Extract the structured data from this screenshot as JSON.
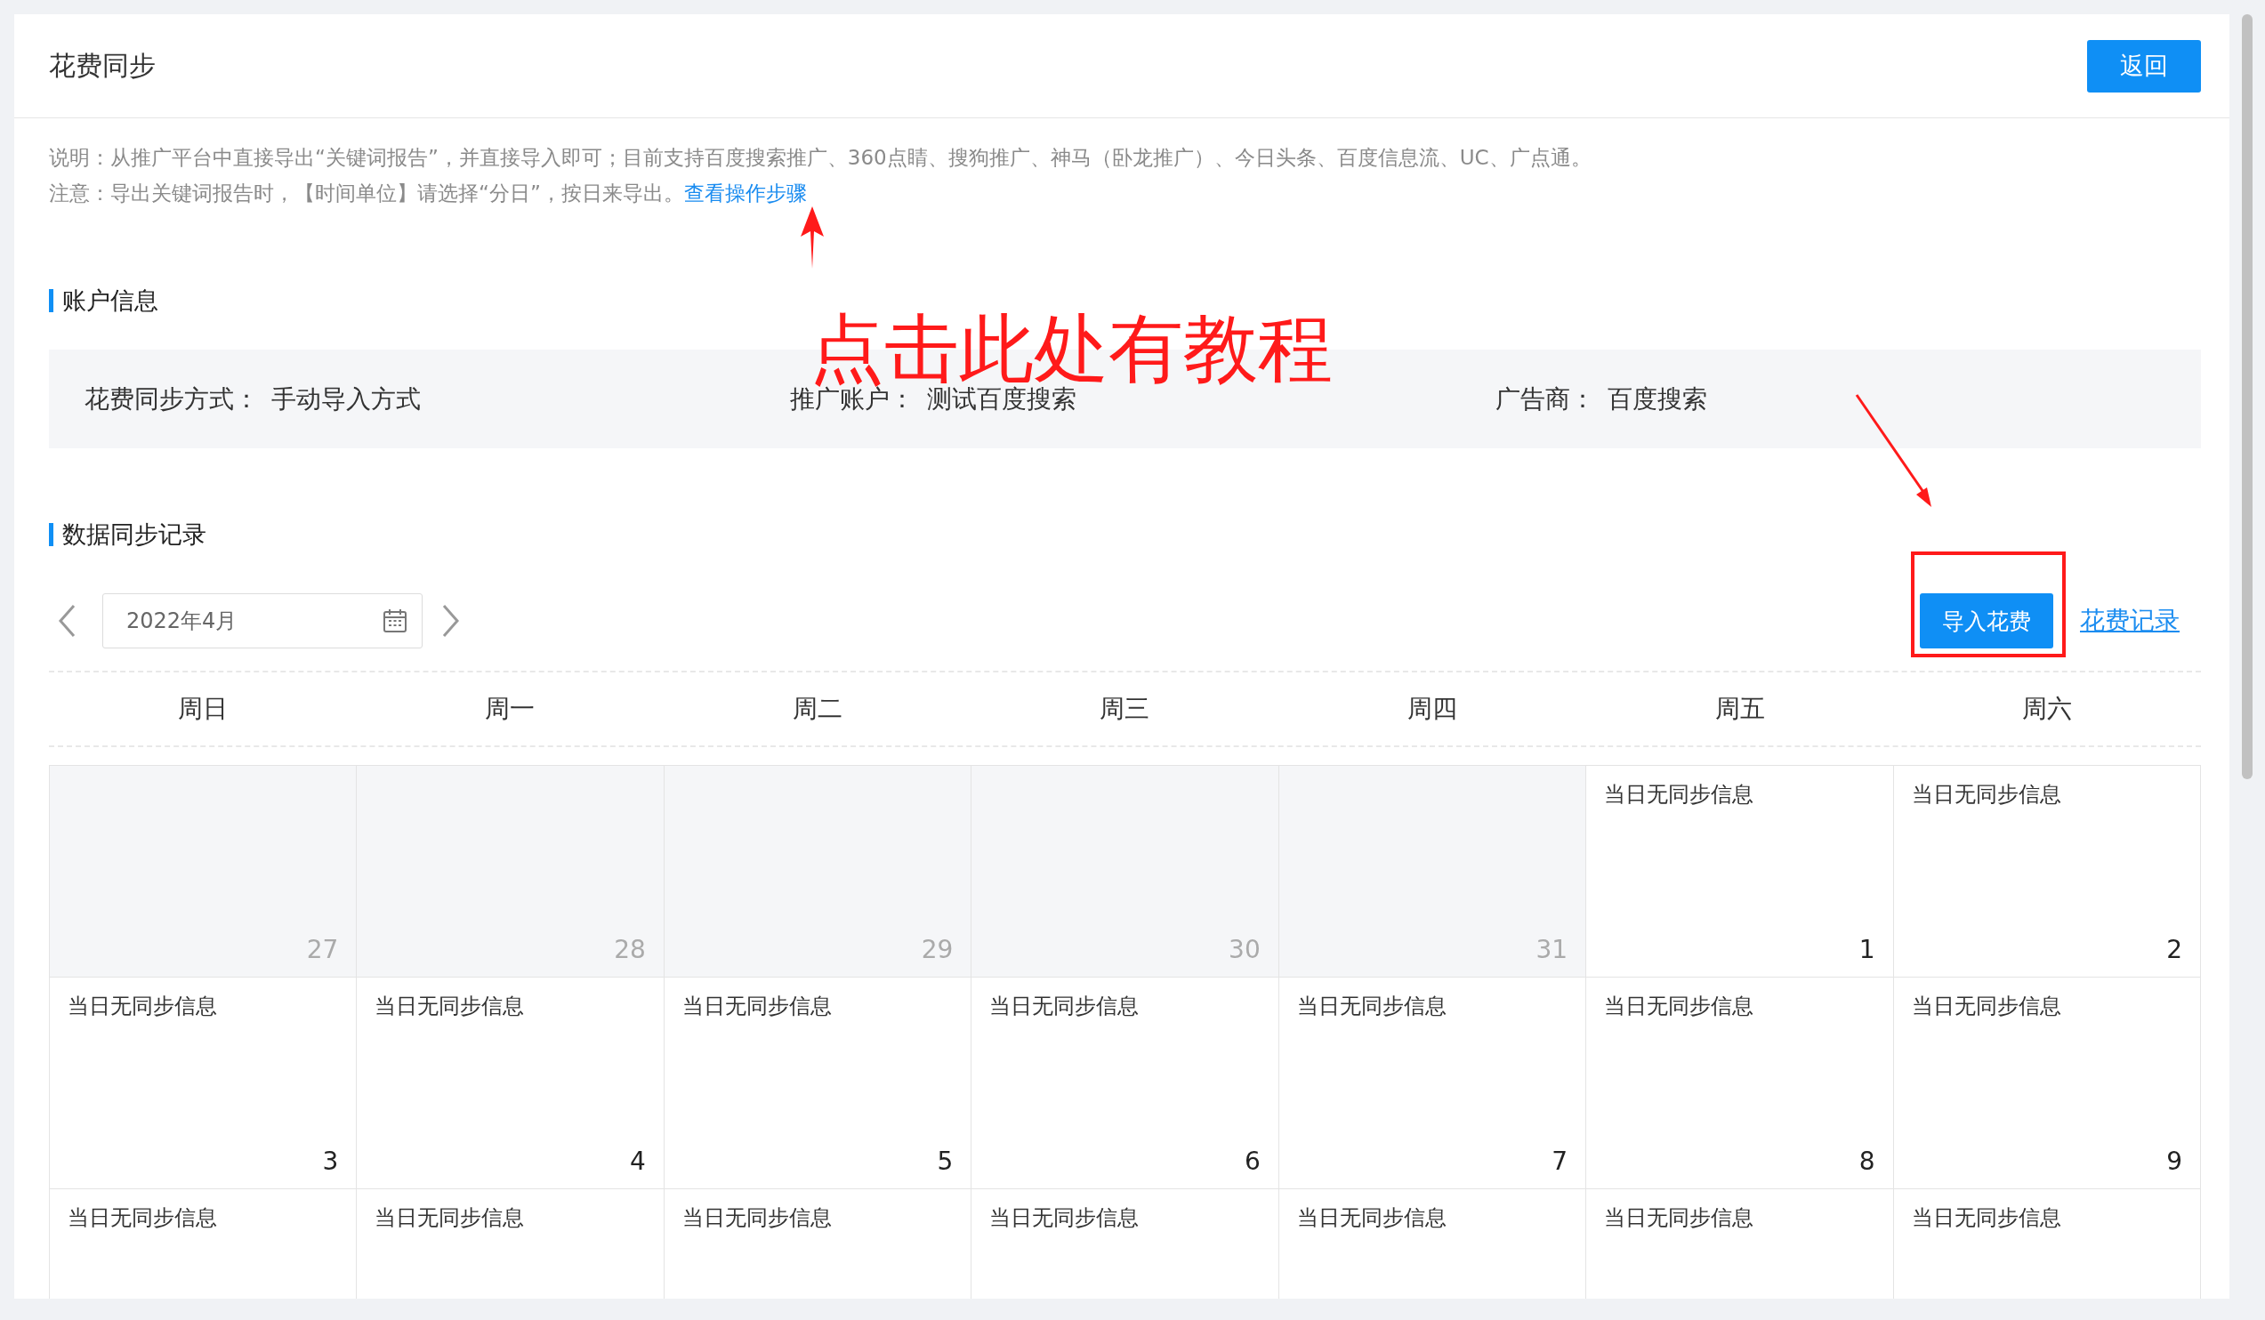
{
  "header": {
    "title": "花费同步",
    "back_button": "返回"
  },
  "notes": [
    {
      "text": "说明：从推广平台中直接导出“关键词报告”，并直接导入即可；目前支持百度搜索推广、360点睛、搜狗推广、神马（卧龙推广）、今日头条、百度信息流、UC、广点通。"
    },
    {
      "text": "注意：导出关键词报告时，【时间单位】请选择“分日”，按日来导出。",
      "link": "查看操作步骤"
    }
  ],
  "account_section": {
    "title": "账户信息",
    "fields": [
      {
        "label": "花费同步方式：",
        "value": "手动导入方式"
      },
      {
        "label": "推广账户：",
        "value": "测试百度搜索"
      },
      {
        "label": "广告商：",
        "value": "百度搜索"
      }
    ]
  },
  "annotation": {
    "text": "点击此处有教程"
  },
  "records_section": {
    "title": "数据同步记录",
    "month": "2022年4月",
    "import_button": "导入花费",
    "history_link": "花费记录",
    "weekdays": [
      "周日",
      "周一",
      "周二",
      "周三",
      "周四",
      "周五",
      "周六"
    ],
    "weeks": [
      [
        {
          "day": "27",
          "other_month": true
        },
        {
          "day": "28",
          "other_month": true
        },
        {
          "day": "29",
          "other_month": true
        },
        {
          "day": "30",
          "other_month": true
        },
        {
          "day": "31",
          "other_month": true
        },
        {
          "day": "1",
          "other_month": false,
          "note": "当日无同步信息"
        },
        {
          "day": "2",
          "other_month": false,
          "note": "当日无同步信息"
        }
      ],
      [
        {
          "day": "3",
          "other_month": false,
          "note": "当日无同步信息"
        },
        {
          "day": "4",
          "other_month": false,
          "note": "当日无同步信息"
        },
        {
          "day": "5",
          "other_month": false,
          "note": "当日无同步信息"
        },
        {
          "day": "6",
          "other_month": false,
          "note": "当日无同步信息"
        },
        {
          "day": "7",
          "other_month": false,
          "note": "当日无同步信息"
        },
        {
          "day": "8",
          "other_month": false,
          "note": "当日无同步信息"
        },
        {
          "day": "9",
          "other_month": false,
          "note": "当日无同步信息"
        }
      ],
      [
        {
          "note": "当日无同步信息"
        },
        {
          "note": "当日无同步信息"
        },
        {
          "note": "当日无同步信息"
        },
        {
          "note": "当日无同步信息"
        },
        {
          "note": "当日无同步信息"
        },
        {
          "note": "当日无同步信息"
        },
        {
          "note": "当日无同步信息"
        }
      ]
    ]
  }
}
